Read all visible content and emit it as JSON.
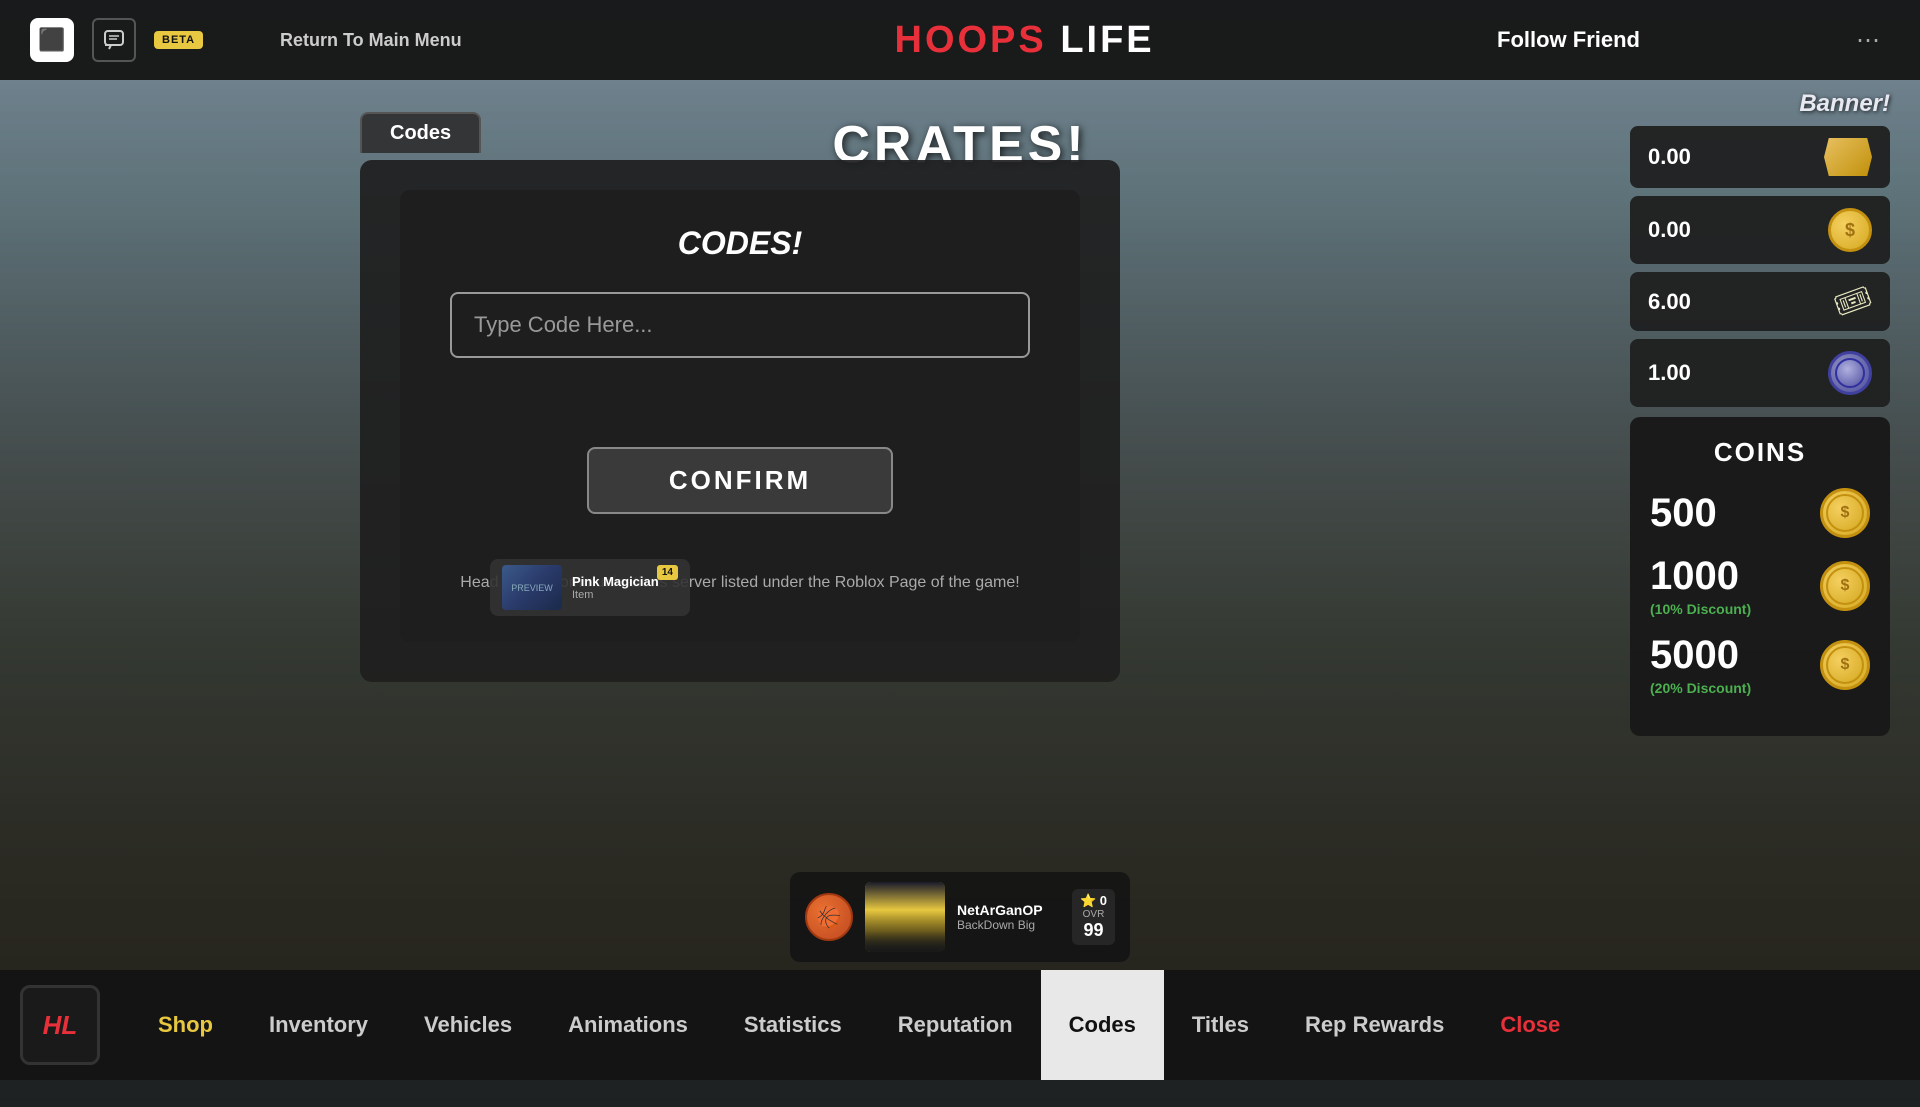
{
  "topbar": {
    "return_label": "Return To Main Menu",
    "title_hoops": "HOOPS",
    "title_space": " ",
    "title_life": "LIFE",
    "follow_label": "Follow Friend"
  },
  "crates": {
    "title": "CRATES!"
  },
  "codes_tab": {
    "tab_label": "Codes",
    "panel_title": "CODES!",
    "input_placeholder": "Type Code Here...",
    "confirm_label": "CONFIRM",
    "footer_text": "Head to our Communications server listed under the Roblox Page of the game!",
    "preview_name": "Pink Magician",
    "preview_count": "14"
  },
  "currency": {
    "banner_label": "Banner!",
    "gold_value": "0.00",
    "coin_value": "0.00",
    "ticket_value": "6.00",
    "token_value": "1.00"
  },
  "coins_shop": {
    "title": "COINS",
    "option1_amount": "500",
    "option2_amount": "1000",
    "option2_discount": "(10% Discount)",
    "option3_amount": "5000",
    "option3_discount": "(20% Discount)"
  },
  "bottom_nav": {
    "logo": "HL",
    "shop_label": "Shop",
    "inventory_label": "Inventory",
    "vehicles_label": "Vehicles",
    "animations_label": "Animations",
    "statistics_label": "Statistics",
    "reputation_label": "Reputation",
    "codes_label": "Codes",
    "titles_label": "Titles",
    "rep_rewards_label": "Rep Rewards",
    "close_label": "Close"
  },
  "player": {
    "name": "NetArGanOP",
    "subtitle": "BackDown Big",
    "score": "0",
    "ovr_label": "OVR",
    "ovr_value": "99"
  }
}
